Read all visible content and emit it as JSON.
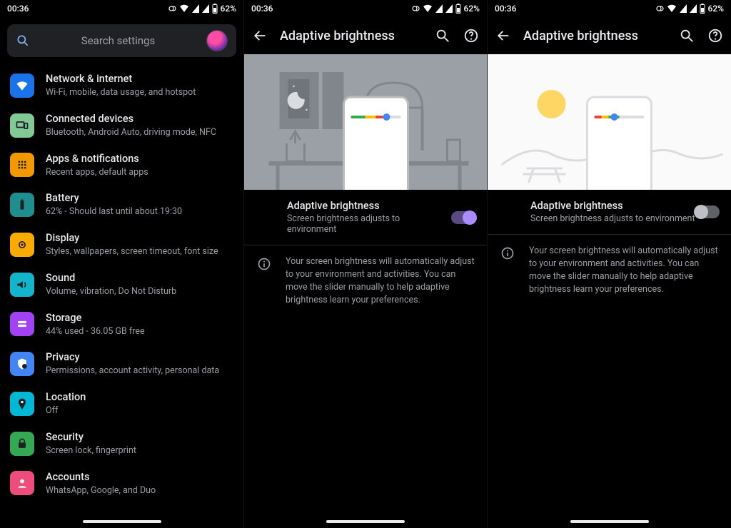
{
  "status": {
    "time": "00:36",
    "battery_text": "62%"
  },
  "search": {
    "placeholder": "Search settings"
  },
  "settings_items": [
    {
      "title": "Network & internet",
      "sub": "Wi-Fi, mobile, data usage, and hotspot"
    },
    {
      "title": "Connected devices",
      "sub": "Bluetooth, Android Auto, driving mode, NFC"
    },
    {
      "title": "Apps & notifications",
      "sub": "Recent apps, default apps"
    },
    {
      "title": "Battery",
      "sub": "62% - Should last until about 19:30"
    },
    {
      "title": "Display",
      "sub": "Styles, wallpapers, screen timeout, font size"
    },
    {
      "title": "Sound",
      "sub": "Volume, vibration, Do Not Disturb"
    },
    {
      "title": "Storage",
      "sub": "44% used - 36.05 GB free"
    },
    {
      "title": "Privacy",
      "sub": "Permissions, account activity, personal data"
    },
    {
      "title": "Location",
      "sub": "Off"
    },
    {
      "title": "Security",
      "sub": "Screen lock, fingerprint"
    },
    {
      "title": "Accounts",
      "sub": "WhatsApp, Google, and Duo"
    }
  ],
  "adaptive": {
    "header_title": "Adaptive brightness",
    "setting_title": "Adaptive brightness",
    "setting_sub": "Screen brightness adjusts to environment",
    "info_text": "Your screen brightness will automatically adjust to your environment and activities. You can move the slider manually to help adaptive brightness learn your preferences.",
    "toggle_on": true,
    "toggle_off": false
  }
}
